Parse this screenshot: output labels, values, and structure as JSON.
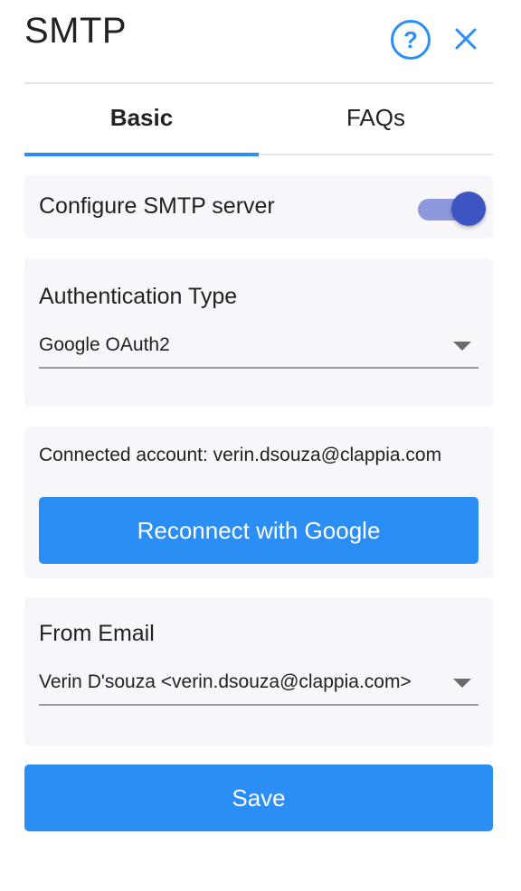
{
  "header": {
    "title": "SMTP",
    "help_symbol": "?",
    "help_icon": "question-circle-icon",
    "close_icon": "close-x-icon"
  },
  "tabs": [
    {
      "label": "Basic",
      "active": true
    },
    {
      "label": "FAQs",
      "active": false
    }
  ],
  "smtp_config": {
    "label": "Configure SMTP server",
    "enabled": true
  },
  "auth": {
    "label": "Authentication Type",
    "value": "Google OAuth2"
  },
  "connection": {
    "text": "Connected account: verin.dsouza@clappia.com",
    "reconnect_label": "Reconnect with Google"
  },
  "from_email": {
    "label": "From Email",
    "value": "Verin D'souza <verin.dsouza@clappia.com>"
  },
  "footer": {
    "save_label": "Save"
  },
  "colors": {
    "accent": "#2b8ef5",
    "toggle_track": "#8d98dc",
    "toggle_thumb": "#3d55c2",
    "card_bg": "#f7f6fa"
  }
}
